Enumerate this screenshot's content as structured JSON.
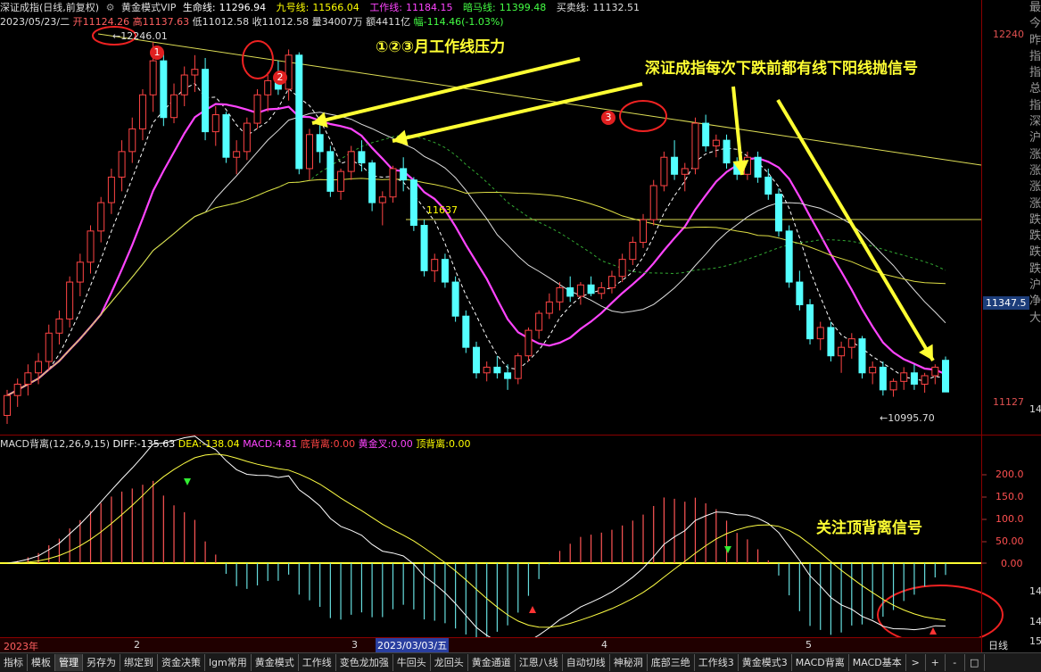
{
  "header": {
    "name": "深证成指(日线,前复权)",
    "indicator_name": "黄金模式VIP",
    "lines": [
      {
        "label": "生命线:",
        "value": "11296.94",
        "color": "#ffffff"
      },
      {
        "label": "九号线:",
        "value": "11566.04",
        "color": "#ffff00"
      },
      {
        "label": "工作线:",
        "value": "11184.15",
        "color": "#ff44ff"
      },
      {
        "label": "暗马线:",
        "value": "11399.48",
        "color": "#44ff44"
      },
      {
        "label": "买卖线:",
        "value": "11132.51",
        "color": "#dddddd"
      }
    ],
    "ohlc": {
      "date": "2023/05/23/二",
      "open": "开11124.26",
      "high": "高11137.63",
      "low": "低11012.58",
      "close": "收11012.58",
      "volume": "量34007万",
      "amount": "额4411亿",
      "change": "幅-114.46(-1.03%)"
    }
  },
  "macd_header": {
    "title": "MACD背离(12,26,9,15)",
    "items": [
      {
        "label": "DIFF:",
        "value": "-135.63",
        "color": "#ffffff"
      },
      {
        "label": "DEA:",
        "value": "-138.04",
        "color": "#ffff00"
      },
      {
        "label": "MACD:",
        "value": "4.81",
        "color": "#ff44ff"
      },
      {
        "label": "底背离:",
        "value": "0.00",
        "color": "#ff4444"
      },
      {
        "label": "黄金叉:",
        "value": "0.00",
        "color": "#ff44ff"
      },
      {
        "label": "顶背离:",
        "value": "0.00",
        "color": "#ffff00"
      }
    ]
  },
  "price_axis": [
    "12240",
    "11347.5",
    "11127",
    "14"
  ],
  "macd_axis": [
    "200.0",
    "150.0",
    "100.0",
    "50.00",
    "0.00",
    "14",
    "14",
    "15"
  ],
  "chart_labels": {
    "high_mark": "12246.01",
    "mid_mark": "11637",
    "low_mark": "10995.70"
  },
  "annotations": {
    "pressure": "①②③月工作线压力",
    "signal": "深证成指每次下跌前都有线下阳线抛信号",
    "divergence": "关注顶背离信号"
  },
  "markers": [
    "1",
    "2",
    "3"
  ],
  "time_axis": {
    "year": "2023年",
    "m2": "2",
    "m3": "3",
    "cursor_date": "2023/03/03/五",
    "m4": "4",
    "m5": "5",
    "period": "日线"
  },
  "right_column": [
    "最",
    "今",
    "昨",
    "指",
    "指",
    "总",
    "指",
    "深",
    "沪",
    "涨",
    "涨",
    "涨",
    "涨",
    "跌",
    "跌",
    "跌",
    "跌",
    "沪",
    "净",
    "大"
  ],
  "price_box": "11347.5",
  "bottom_tabs": [
    "指标",
    "模板",
    "管理",
    "另存为",
    "绑定到",
    "资金决策",
    "lgm常用",
    "黄金模式",
    "工作线",
    "变色龙加强",
    "牛回头",
    "龙回头",
    "黄金通道",
    "江恩八线",
    "自动切线",
    "神秘洞",
    "底部三绝",
    "工作线3",
    "黄金模式3",
    "MACD背离",
    "MACD基本"
  ],
  "bottom_tab_active": 2,
  "bottom_controls": {
    "next": ">",
    "plus": "+",
    "minus": "-",
    "fit": "□"
  },
  "chart_data": {
    "type": "candlestick",
    "series": [
      {
        "name": "生命线",
        "values": []
      },
      {
        "name": "九号线",
        "values": []
      },
      {
        "name": "工作线",
        "values": []
      }
    ],
    "candles": [
      [
        10930,
        11020,
        10900,
        11000
      ],
      [
        11000,
        11060,
        10960,
        11040
      ],
      [
        11040,
        11110,
        11000,
        11080
      ],
      [
        11080,
        11150,
        11040,
        11120
      ],
      [
        11120,
        11250,
        11090,
        11220
      ],
      [
        11220,
        11300,
        11180,
        11270
      ],
      [
        11270,
        11420,
        11240,
        11400
      ],
      [
        11400,
        11500,
        11350,
        11470
      ],
      [
        11470,
        11600,
        11430,
        11580
      ],
      [
        11580,
        11700,
        11540,
        11680
      ],
      [
        11680,
        11800,
        11640,
        11770
      ],
      [
        11770,
        11900,
        11720,
        11860
      ],
      [
        11860,
        11980,
        11820,
        11940
      ],
      [
        11940,
        12080,
        11900,
        12060
      ],
      [
        12060,
        12246.01,
        12000,
        12180
      ],
      [
        12180,
        12210,
        11950,
        11980
      ],
      [
        11980,
        12100,
        11960,
        12060
      ],
      [
        12060,
        12160,
        12020,
        12130
      ],
      [
        12130,
        12200,
        12070,
        12150
      ],
      [
        12150,
        12190,
        11900,
        11930
      ],
      [
        11930,
        12020,
        11880,
        11990
      ],
      [
        11990,
        12000,
        11820,
        11840
      ],
      [
        11840,
        11900,
        11780,
        11860
      ],
      [
        11860,
        11980,
        11830,
        11960
      ],
      [
        11960,
        12080,
        11940,
        12060
      ],
      [
        12060,
        12140,
        12000,
        12110
      ],
      [
        12110,
        12180,
        12060,
        12080
      ],
      [
        12080,
        12220,
        12040,
        12200
      ],
      [
        12200,
        12210,
        11780,
        11800
      ],
      [
        11800,
        11940,
        11760,
        11920
      ],
      [
        11920,
        11960,
        11820,
        11860
      ],
      [
        11860,
        11880,
        11700,
        11720
      ],
      [
        11720,
        11800,
        11690,
        11790
      ],
      [
        11790,
        11880,
        11760,
        11860
      ],
      [
        11860,
        11900,
        11790,
        11820
      ],
      [
        11820,
        11830,
        11650,
        11680
      ],
      [
        11680,
        11720,
        11600,
        11700
      ],
      [
        11700,
        11810,
        11680,
        11800
      ],
      [
        11800,
        11840,
        11720,
        11760
      ],
      [
        11760,
        11770,
        11580,
        11600
      ],
      [
        11600,
        11620,
        11420,
        11440
      ],
      [
        11440,
        11500,
        11400,
        11480
      ],
      [
        11480,
        11500,
        11380,
        11400
      ],
      [
        11400,
        11420,
        11260,
        11280
      ],
      [
        11280,
        11300,
        11150,
        11170
      ],
      [
        11170,
        11190,
        11060,
        11080
      ],
      [
        11080,
        11120,
        11050,
        11100
      ],
      [
        11100,
        11140,
        11060,
        11080
      ],
      [
        11080,
        11110,
        11020,
        11060
      ],
      [
        11060,
        11150,
        11040,
        11140
      ],
      [
        11140,
        11240,
        11120,
        11230
      ],
      [
        11230,
        11300,
        11200,
        11290
      ],
      [
        11290,
        11360,
        11270,
        11330
      ],
      [
        11330,
        11400,
        11300,
        11380
      ],
      [
        11380,
        11420,
        11330,
        11350
      ],
      [
        11350,
        11400,
        11320,
        11390
      ],
      [
        11390,
        11420,
        11350,
        11360
      ],
      [
        11360,
        11400,
        11340,
        11380
      ],
      [
        11380,
        11440,
        11360,
        11420
      ],
      [
        11420,
        11500,
        11400,
        11480
      ],
      [
        11480,
        11560,
        11460,
        11540
      ],
      [
        11540,
        11640,
        11520,
        11620
      ],
      [
        11620,
        11760,
        11600,
        11740
      ],
      [
        11740,
        11860,
        11720,
        11840
      ],
      [
        11840,
        11900,
        11760,
        11780
      ],
      [
        11780,
        11820,
        11720,
        11800
      ],
      [
        11800,
        11980,
        11780,
        11960
      ],
      [
        11960,
        11990,
        11860,
        11880
      ],
      [
        11880,
        11920,
        11840,
        11900
      ],
      [
        11900,
        11920,
        11800,
        11820
      ],
      [
        11820,
        11840,
        11760,
        11780
      ],
      [
        11780,
        11860,
        11760,
        11840
      ],
      [
        11840,
        11860,
        11750,
        11770
      ],
      [
        11770,
        11800,
        11690,
        11710
      ],
      [
        11710,
        11730,
        11560,
        11580
      ],
      [
        11580,
        11600,
        11380,
        11400
      ],
      [
        11400,
        11440,
        11300,
        11320
      ],
      [
        11320,
        11340,
        11180,
        11200
      ],
      [
        11200,
        11260,
        11160,
        11240
      ],
      [
        11240,
        11260,
        11120,
        11140
      ],
      [
        11140,
        11190,
        11080,
        11170
      ],
      [
        11170,
        11220,
        11130,
        11200
      ],
      [
        11200,
        11210,
        11060,
        11080
      ],
      [
        11080,
        11120,
        11040,
        11100
      ],
      [
        11100,
        11120,
        11000,
        11020
      ],
      [
        11020,
        11060,
        10995.7,
        11050
      ],
      [
        11050,
        11100,
        11020,
        11080
      ],
      [
        11080,
        11110,
        11020,
        11040
      ],
      [
        11040,
        11080,
        11010,
        11070
      ],
      [
        11070,
        11110,
        11040,
        11100
      ],
      [
        11124.26,
        11137.63,
        11012.58,
        11012.58
      ]
    ],
    "ylim": [
      10900,
      12300
    ]
  }
}
